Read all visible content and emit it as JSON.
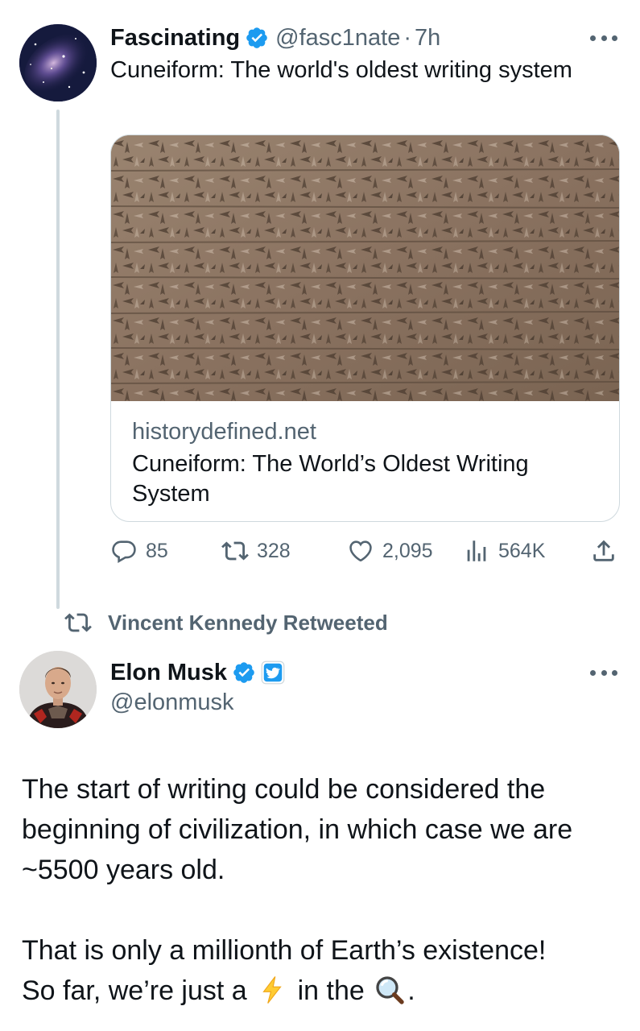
{
  "tweet1": {
    "author": {
      "name": "Fascinating",
      "handle": "@fasc1nate",
      "verified": true
    },
    "separator": "·",
    "time": "7h",
    "text": "Cuneiform: The world's oldest writing system",
    "card": {
      "image_alt": "Cuneiform inscription on stone",
      "domain": "historydefined.net",
      "title": "Cuneiform: The World’s Oldest Writing System"
    },
    "actions": {
      "replies": "85",
      "retweets": "328",
      "likes": "2,095",
      "views": "564K"
    }
  },
  "retweet_banner": {
    "text": "Vincent Kennedy Retweeted"
  },
  "tweet2": {
    "author": {
      "name": "Elon Musk",
      "handle": "@elonmusk",
      "verified": true,
      "affiliate_badge": "twitter-bird"
    },
    "paragraphs": [
      "The start of writing could be considered the beginning of civilization, in which case we are ~5500 years old.",
      "That is only a millionth of Earth’s existence!"
    ],
    "last_line": {
      "before": "So far, we’re just a",
      "emoji1": "lightning-emoji",
      "middle": "in the",
      "emoji2": "magnifier-emoji",
      "after": "."
    }
  },
  "colors": {
    "text": "#0f1419",
    "secondary": "#536471",
    "verified": "#1d9bf0",
    "border": "#cfd9de"
  }
}
